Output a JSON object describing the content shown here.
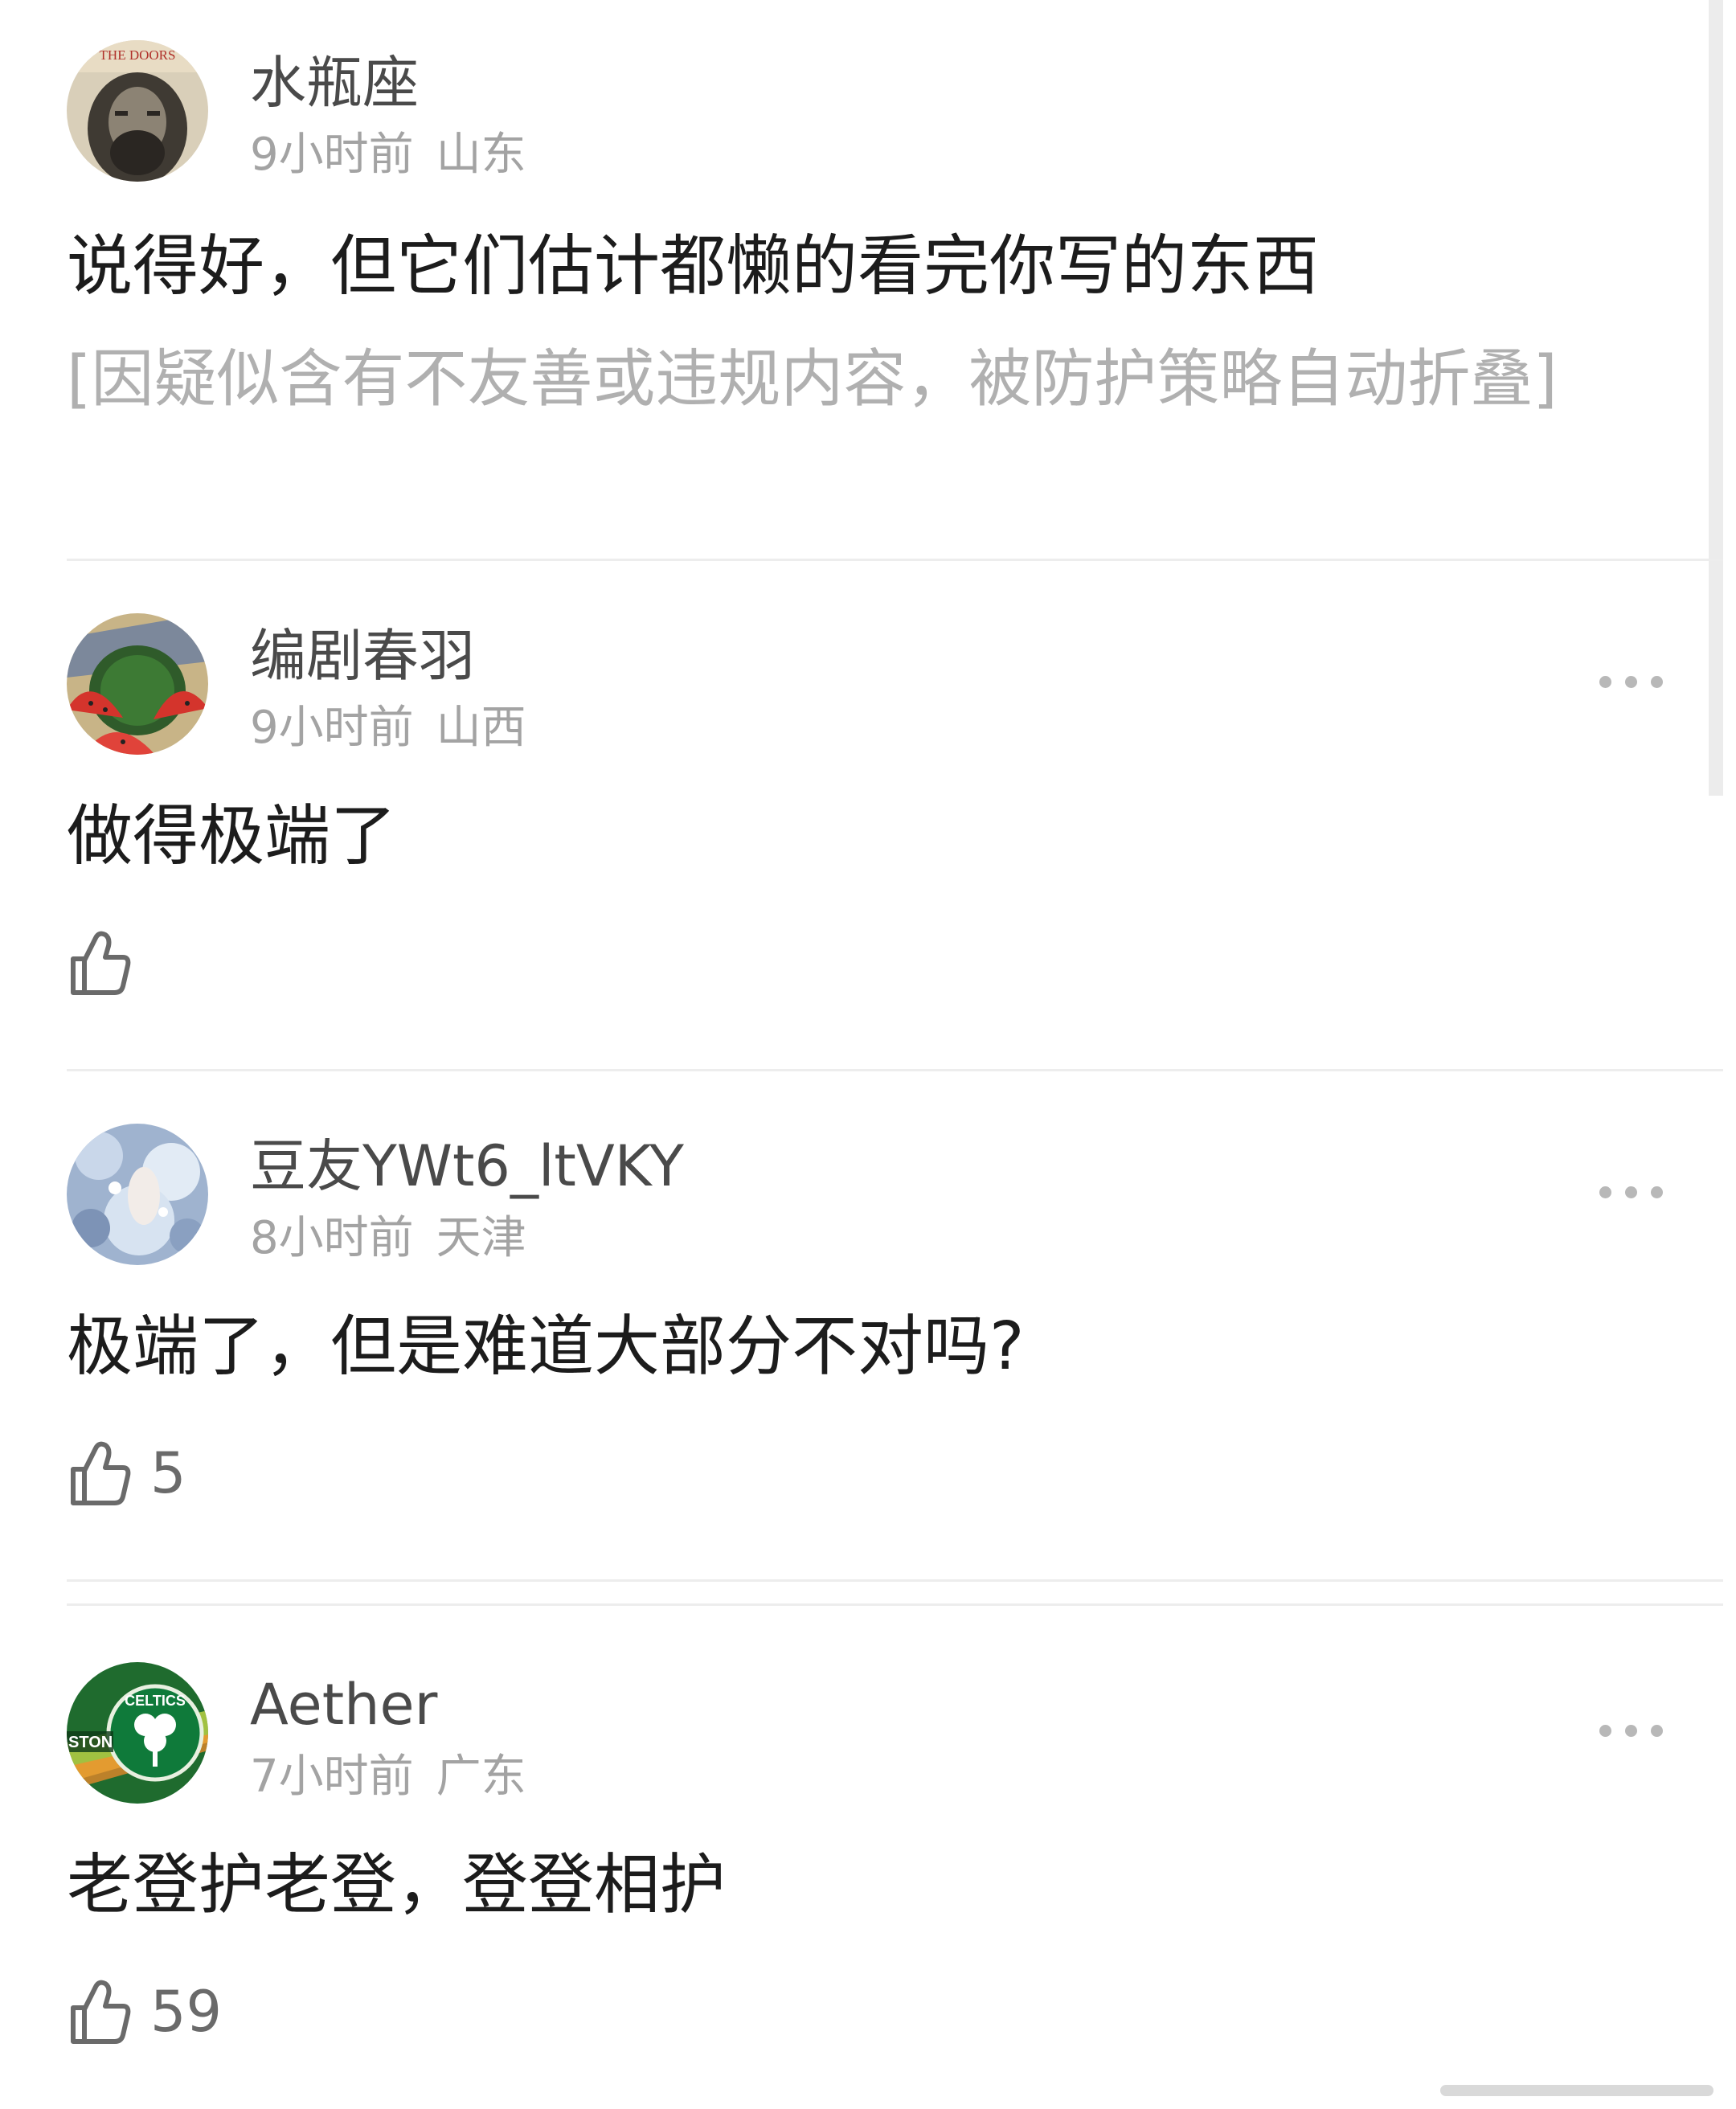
{
  "comments": [
    {
      "username": "水瓶座",
      "time": "9小时前",
      "location": "山东",
      "text": "说得好，但它们估计都懒的看完你写的东西",
      "folded_notice": "[因疑似含有不友善或违规内容，被防护策略自动折叠]",
      "avatar_text": "THE DOORS"
    },
    {
      "username": "编剧春羽",
      "time": "9小时前",
      "location": "山西",
      "text": "做得极端了",
      "likes": ""
    },
    {
      "username": "豆友YWt6_ltVKY",
      "time": "8小时前",
      "location": "天津",
      "text": "极端了，但是难道大部分不对吗?",
      "likes": "5"
    },
    {
      "username": "Aether",
      "time": "7小时前",
      "location": "广东",
      "text": "老登护老登，登登相护",
      "likes": "59",
      "avatar_text": "CELTICS",
      "avatar_text_2": "STON"
    }
  ],
  "icons": {
    "more": "more-dots-icon",
    "like": "thumbs-up-icon"
  },
  "colors": {
    "name": "#4a4a4a",
    "meta": "#a3a3a3",
    "folded": "#b0b0b0",
    "divider": "#ededed"
  }
}
